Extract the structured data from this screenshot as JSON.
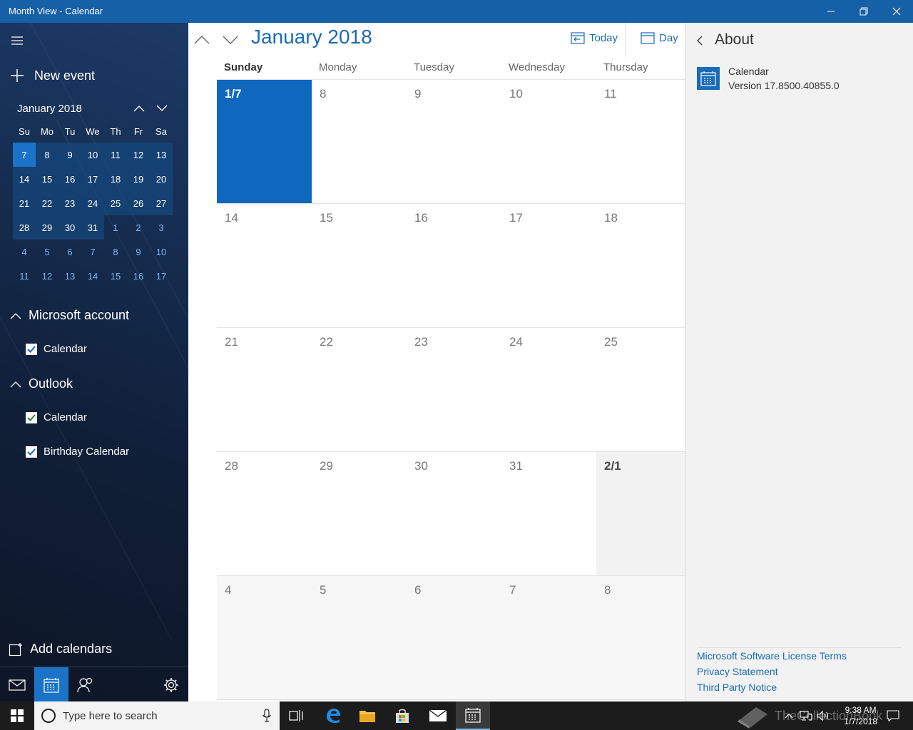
{
  "window": {
    "title": "Month View - Calendar"
  },
  "sidebar": {
    "new_event": "New event",
    "mini_calendar": {
      "title": "January 2018",
      "dow": [
        "Su",
        "Mo",
        "Tu",
        "We",
        "Th",
        "Fr",
        "Sa"
      ],
      "days": [
        {
          "d": "7",
          "s": "today"
        },
        {
          "d": "8",
          "s": "in"
        },
        {
          "d": "9",
          "s": "in"
        },
        {
          "d": "10",
          "s": "in"
        },
        {
          "d": "11",
          "s": "in"
        },
        {
          "d": "12",
          "s": "in"
        },
        {
          "d": "13",
          "s": "in"
        },
        {
          "d": "14",
          "s": "in"
        },
        {
          "d": "15",
          "s": "in"
        },
        {
          "d": "16",
          "s": "in"
        },
        {
          "d": "17",
          "s": "in"
        },
        {
          "d": "18",
          "s": "in"
        },
        {
          "d": "19",
          "s": "in"
        },
        {
          "d": "20",
          "s": "in"
        },
        {
          "d": "21",
          "s": "in"
        },
        {
          "d": "22",
          "s": "in"
        },
        {
          "d": "23",
          "s": "in"
        },
        {
          "d": "24",
          "s": "in"
        },
        {
          "d": "25",
          "s": "in"
        },
        {
          "d": "26",
          "s": "in"
        },
        {
          "d": "27",
          "s": "in"
        },
        {
          "d": "28",
          "s": "in"
        },
        {
          "d": "29",
          "s": "in"
        },
        {
          "d": "30",
          "s": "in"
        },
        {
          "d": "31",
          "s": "in"
        },
        {
          "d": "1",
          "s": "out"
        },
        {
          "d": "2",
          "s": "out"
        },
        {
          "d": "3",
          "s": "out"
        },
        {
          "d": "4",
          "s": "out"
        },
        {
          "d": "5",
          "s": "out"
        },
        {
          "d": "6",
          "s": "out"
        },
        {
          "d": "7",
          "s": "out"
        },
        {
          "d": "8",
          "s": "out"
        },
        {
          "d": "9",
          "s": "out"
        },
        {
          "d": "10",
          "s": "out"
        },
        {
          "d": "11",
          "s": "out"
        },
        {
          "d": "12",
          "s": "out"
        },
        {
          "d": "13",
          "s": "out"
        },
        {
          "d": "14",
          "s": "out"
        },
        {
          "d": "15",
          "s": "out"
        },
        {
          "d": "16",
          "s": "out"
        },
        {
          "d": "17",
          "s": "out"
        }
      ]
    },
    "groups": [
      {
        "label": "Microsoft account",
        "calendars": [
          {
            "label": "Calendar",
            "checked": true,
            "color": "#1a6bb8"
          }
        ]
      },
      {
        "label": "Outlook",
        "calendars": [
          {
            "label": "Calendar",
            "checked": true,
            "color": "#2e8b3a"
          },
          {
            "label": "Birthday Calendar",
            "checked": true,
            "color": "#1a6bb8"
          }
        ]
      }
    ],
    "add_calendars": "Add calendars"
  },
  "main": {
    "month_title": "January 2018",
    "today_label": "Today",
    "view_label": "Day",
    "dow": [
      "Sunday",
      "Monday",
      "Tuesday",
      "Wednesday",
      "Thursday"
    ],
    "weeks": [
      [
        "1/7",
        "8",
        "9",
        "10",
        "11"
      ],
      [
        "14",
        "15",
        "16",
        "17",
        "18"
      ],
      [
        "21",
        "22",
        "23",
        "24",
        "25"
      ],
      [
        "28",
        "29",
        "30",
        "31",
        "2/1"
      ],
      [
        "4",
        "5",
        "6",
        "7",
        "8"
      ]
    ]
  },
  "about": {
    "title": "About",
    "app_name": "Calendar",
    "version": "Version 17.8500.40855.0",
    "links": [
      "Microsoft Software License Terms",
      "Privacy Statement",
      "Third Party Notice"
    ]
  },
  "taskbar": {
    "search_placeholder": "Type here to search",
    "time": "9:38 AM",
    "date": "1/7/2018",
    "watermark": "TheCollectionBook"
  },
  "colors": {
    "accent": "#1a6bb8",
    "titlebar": "#1660a8",
    "selected": "#0f68bd"
  }
}
